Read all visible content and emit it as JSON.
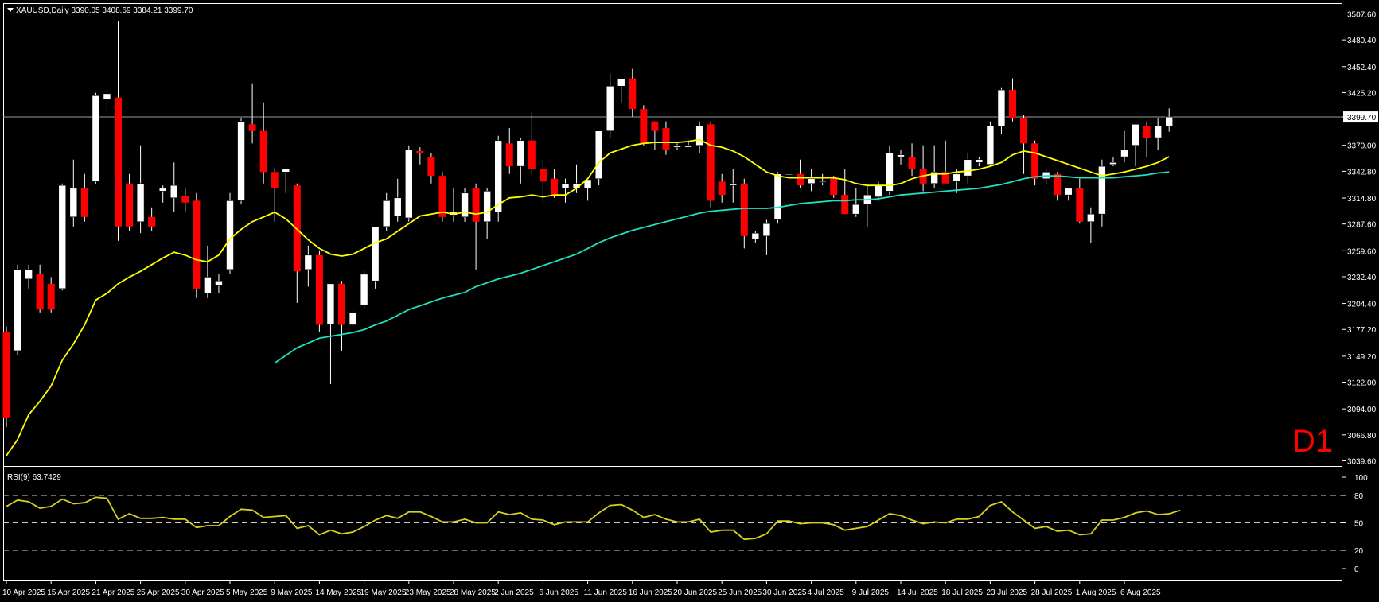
{
  "header": {
    "symbol_line": "XAUUSD,Daily  3390.05 3408.69 3384.21 3399.70",
    "timeframe_watermark": "D1"
  },
  "rsi_panel": {
    "label": "RSI(9) 63.7429"
  },
  "colors": {
    "background": "#000000",
    "frame": "#ffffff",
    "bull_candle": "#ffffff",
    "bear_candle": "#ff0000",
    "wick": "#ffffff",
    "ma_fast": "#ffff00",
    "ma_slow": "#20e0c0",
    "rsi_line": "#d8d020",
    "current_price_line": "#9a9aa8",
    "watermark": "#ff0000"
  },
  "chart_data": [
    {
      "type": "candlestick",
      "title": "XAUUSD,Daily",
      "price_axis": {
        "ticks": [
          "3507.60",
          "3480.40",
          "3452.40",
          "3425.20",
          "3399.70",
          "3370.00",
          "3342.80",
          "3314.80",
          "3287.60",
          "3259.60",
          "3232.40",
          "3204.40",
          "3177.20",
          "3149.20",
          "3122.00",
          "3094.00",
          "3066.80",
          "3039.60"
        ],
        "range": [
          3035,
          3518
        ],
        "current_price": 3399.7
      },
      "date_axis": {
        "labels": [
          "10 Apr 2025",
          "15 Apr 2025",
          "21 Apr 2025",
          "25 Apr 2025",
          "30 Apr 2025",
          "5 May 2025",
          "9 May 2025",
          "14 May 2025",
          "19 May 2025",
          "23 May 2025",
          "28 May 2025",
          "2 Jun 2025",
          "6 Jun 2025",
          "11 Jun 2025",
          "16 Jun 2025",
          "20 Jun 2025",
          "25 Jun 2025",
          "30 Jun 2025",
          "4 Jul 2025",
          "9 Jul 2025",
          "14 Jul 2025",
          "18 Jul 2025",
          "23 Jul 2025",
          "28 Jul 2025",
          "1 Aug 2025",
          "6 Aug 2025"
        ],
        "label_every_bars": 4
      },
      "candles": [
        [
          3175,
          3180,
          3075,
          3085
        ],
        [
          3155,
          3245,
          3150,
          3240
        ],
        [
          3230,
          3245,
          3220,
          3240
        ],
        [
          3235,
          3245,
          3195,
          3198
        ],
        [
          3225,
          3232,
          3195,
          3198
        ],
        [
          3220,
          3330,
          3218,
          3328
        ],
        [
          3295,
          3355,
          3285,
          3325
        ],
        [
          3325,
          3340,
          3290,
          3295
        ],
        [
          3332,
          3425,
          3330,
          3422
        ],
        [
          3418,
          3428,
          3405,
          3424
        ],
        [
          3420,
          3500,
          3270,
          3285
        ],
        [
          3330,
          3340,
          3280,
          3285
        ],
        [
          3290,
          3370,
          3278,
          3330
        ],
        [
          3295,
          3305,
          3280,
          3285
        ],
        [
          3322,
          3328,
          3310,
          3325
        ],
        [
          3315,
          3352,
          3300,
          3328
        ],
        [
          3317,
          3325,
          3300,
          3310
        ],
        [
          3312,
          3320,
          3210,
          3220
        ],
        [
          3215,
          3265,
          3210,
          3232
        ],
        [
          3223,
          3235,
          3215,
          3228
        ],
        [
          3240,
          3320,
          3235,
          3312
        ],
        [
          3312,
          3398,
          3308,
          3395
        ],
        [
          3392,
          3435,
          3372,
          3385
        ],
        [
          3385,
          3415,
          3330,
          3342
        ],
        [
          3342,
          3345,
          3290,
          3325
        ],
        [
          3342,
          3345,
          3320,
          3345
        ],
        [
          3328,
          3330,
          3205,
          3238
        ],
        [
          3240,
          3265,
          3222,
          3255
        ],
        [
          3255,
          3260,
          3175,
          3182
        ],
        [
          3183,
          3225,
          3120,
          3225
        ],
        [
          3225,
          3228,
          3155,
          3182
        ],
        [
          3182,
          3198,
          3178,
          3195
        ],
        [
          3203,
          3240,
          3198,
          3235
        ],
        [
          3228,
          3282,
          3220,
          3285
        ],
        [
          3285,
          3320,
          3280,
          3312
        ],
        [
          3296,
          3335,
          3290,
          3315
        ],
        [
          3294,
          3370,
          3290,
          3365
        ],
        [
          3364,
          3368,
          3350,
          3362
        ],
        [
          3358,
          3362,
          3330,
          3338
        ],
        [
          3338,
          3342,
          3290,
          3295
        ],
        [
          3297,
          3325,
          3290,
          3300
        ],
        [
          3295,
          3325,
          3290,
          3320
        ],
        [
          3325,
          3330,
          3240,
          3290
        ],
        [
          3290,
          3325,
          3272,
          3322
        ],
        [
          3300,
          3380,
          3290,
          3375
        ],
        [
          3372,
          3388,
          3340,
          3348
        ],
        [
          3348,
          3378,
          3330,
          3375
        ],
        [
          3375,
          3405,
          3340,
          3345
        ],
        [
          3345,
          3355,
          3310,
          3332
        ],
        [
          3335,
          3345,
          3315,
          3318
        ],
        [
          3325,
          3335,
          3310,
          3330
        ],
        [
          3325,
          3350,
          3320,
          3330
        ],
        [
          3325,
          3335,
          3312,
          3334
        ],
        [
          3335,
          3385,
          3328,
          3385
        ],
        [
          3385,
          3445,
          3378,
          3432
        ],
        [
          3432,
          3440,
          3415,
          3440
        ],
        [
          3440,
          3450,
          3400,
          3408
        ],
        [
          3408,
          3412,
          3370,
          3372
        ],
        [
          3395,
          3395,
          3365,
          3385
        ],
        [
          3388,
          3395,
          3360,
          3365
        ],
        [
          3368,
          3372,
          3365,
          3370
        ],
        [
          3368,
          3375,
          3368,
          3370
        ],
        [
          3370,
          3395,
          3362,
          3390
        ],
        [
          3392,
          3395,
          3305,
          3312
        ],
        [
          3332,
          3340,
          3310,
          3318
        ],
        [
          3328,
          3345,
          3310,
          3330
        ],
        [
          3330,
          3335,
          3262,
          3275
        ],
        [
          3272,
          3280,
          3268,
          3278
        ],
        [
          3275,
          3292,
          3255,
          3288
        ],
        [
          3292,
          3342,
          3288,
          3340
        ],
        [
          3340,
          3352,
          3328,
          3340
        ],
        [
          3340,
          3355,
          3325,
          3328
        ],
        [
          3330,
          3345,
          3322,
          3335
        ],
        [
          3332,
          3340,
          3328,
          3332
        ],
        [
          3335,
          3338,
          3315,
          3318
        ],
        [
          3318,
          3345,
          3300,
          3298
        ],
        [
          3298,
          3325,
          3295,
          3308
        ],
        [
          3308,
          3330,
          3285,
          3318
        ],
        [
          3316,
          3332,
          3312,
          3328
        ],
        [
          3322,
          3370,
          3318,
          3362
        ],
        [
          3358,
          3365,
          3350,
          3360
        ],
        [
          3358,
          3372,
          3338,
          3345
        ],
        [
          3345,
          3370,
          3322,
          3330
        ],
        [
          3330,
          3370,
          3325,
          3342
        ],
        [
          3342,
          3375,
          3335,
          3330
        ],
        [
          3332,
          3345,
          3320,
          3340
        ],
        [
          3338,
          3362,
          3330,
          3355
        ],
        [
          3352,
          3358,
          3348,
          3355
        ],
        [
          3350,
          3395,
          3348,
          3390
        ],
        [
          3390,
          3430,
          3382,
          3428
        ],
        [
          3428,
          3440,
          3395,
          3398
        ],
        [
          3398,
          3402,
          3340,
          3372
        ],
        [
          3372,
          3375,
          3328,
          3335
        ],
        [
          3335,
          3345,
          3330,
          3342
        ],
        [
          3340,
          3342,
          3312,
          3318
        ],
        [
          3318,
          3325,
          3312,
          3325
        ],
        [
          3325,
          3335,
          3288,
          3290
        ],
        [
          3290,
          3305,
          3268,
          3298
        ],
        [
          3298,
          3355,
          3285,
          3348
        ],
        [
          3350,
          3358,
          3348,
          3352
        ],
        [
          3358,
          3385,
          3352,
          3365
        ],
        [
          3370,
          3388,
          3348,
          3392
        ],
        [
          3390,
          3395,
          3358,
          3378
        ],
        [
          3378,
          3398,
          3365,
          3390
        ],
        [
          3390,
          3408.69,
          3384.21,
          3399.7
        ]
      ],
      "ma_fast": [
        3045,
        3062,
        3088,
        3102,
        3118,
        3145,
        3162,
        3182,
        3208,
        3215,
        3225,
        3232,
        3238,
        3245,
        3252,
        3258,
        3255,
        3250,
        3248,
        3255,
        3272,
        3282,
        3290,
        3295,
        3300,
        3293,
        3282,
        3271,
        3262,
        3256,
        3254,
        3256,
        3262,
        3268,
        3272,
        3280,
        3288,
        3296,
        3298,
        3300,
        3298,
        3300,
        3298,
        3300,
        3308,
        3315,
        3316,
        3318,
        3316,
        3318,
        3318,
        3325,
        3335,
        3352,
        3362,
        3366,
        3370,
        3372,
        3373,
        3373,
        3373,
        3374,
        3376,
        3370,
        3368,
        3364,
        3358,
        3350,
        3342,
        3338,
        3336,
        3336,
        3336,
        3336,
        3336,
        3334,
        3330,
        3328,
        3328,
        3328,
        3330,
        3335,
        3338,
        3340,
        3340,
        3342,
        3343,
        3345,
        3348,
        3352,
        3360,
        3364,
        3362,
        3358,
        3354,
        3350,
        3346,
        3342,
        3338,
        3340,
        3342,
        3345,
        3348,
        3352,
        3358
      ],
      "ma_slow": [
        null,
        null,
        null,
        null,
        null,
        null,
        null,
        null,
        null,
        null,
        null,
        null,
        null,
        null,
        null,
        null,
        null,
        null,
        null,
        null,
        null,
        null,
        null,
        null,
        3142,
        3150,
        3158,
        3163,
        3168,
        3170,
        3172,
        3174,
        3177,
        3182,
        3186,
        3192,
        3198,
        3202,
        3206,
        3210,
        3213,
        3216,
        3222,
        3226,
        3230,
        3233,
        3236,
        3240,
        3244,
        3248,
        3252,
        3256,
        3262,
        3268,
        3273,
        3277,
        3281,
        3284,
        3287,
        3290,
        3293,
        3296,
        3299,
        3301,
        3302,
        3303,
        3304,
        3304,
        3304,
        3305,
        3307,
        3309,
        3310,
        3311,
        3312,
        3312,
        3313,
        3313,
        3314,
        3316,
        3318,
        3319,
        3320,
        3321,
        3322,
        3323,
        3324,
        3325,
        3327,
        3329,
        3332,
        3335,
        3337,
        3338,
        3338,
        3337,
        3336,
        3336,
        3336,
        3336,
        3337,
        3338,
        3339,
        3341,
        3342
      ]
    },
    {
      "type": "line",
      "title": "RSI(9) 63.7429",
      "ylim": [
        0,
        100
      ],
      "y_ticks": [
        "100",
        "80",
        "50",
        "20",
        "0"
      ],
      "levels": [
        80,
        50,
        20
      ],
      "series": [
        {
          "name": "RSI(9)",
          "values": [
            68,
            75,
            73,
            66,
            68,
            76,
            71,
            72,
            78,
            77,
            54,
            60,
            55,
            55,
            56,
            54,
            54,
            45,
            47,
            47,
            57,
            65,
            64,
            56,
            57,
            58,
            44,
            47,
            37,
            42,
            38,
            40,
            46,
            53,
            58,
            55,
            62,
            62,
            57,
            51,
            51,
            54,
            50,
            50,
            62,
            59,
            61,
            54,
            53,
            48,
            51,
            51,
            51,
            61,
            69,
            70,
            64,
            56,
            59,
            54,
            51,
            51,
            54,
            40,
            42,
            42,
            32,
            33,
            38,
            52,
            52,
            49,
            50,
            50,
            48,
            42,
            44,
            46,
            53,
            60,
            58,
            53,
            49,
            51,
            50,
            54,
            54,
            57,
            69,
            73,
            62,
            53,
            44,
            46,
            41,
            42,
            37,
            38,
            53,
            53,
            56,
            61,
            63,
            59,
            60,
            63.74
          ]
        }
      ]
    }
  ]
}
